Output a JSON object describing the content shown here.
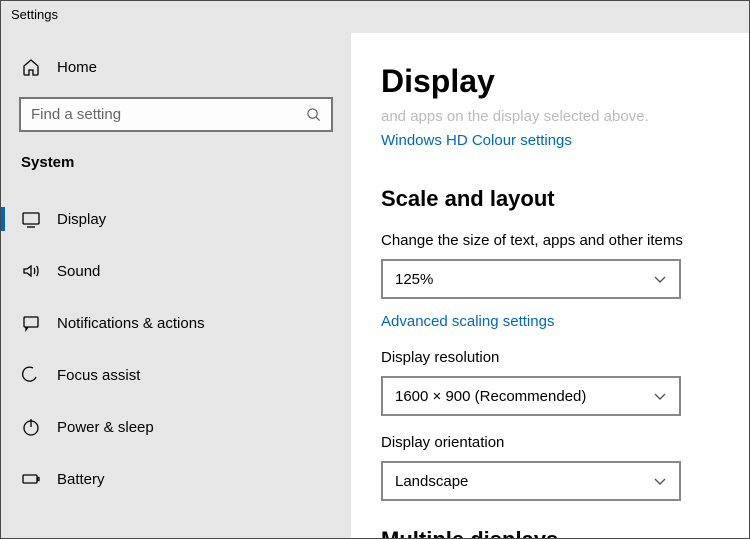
{
  "window": {
    "title": "Settings"
  },
  "sidebar": {
    "home_label": "Home",
    "search_placeholder": "Find a setting",
    "section": "System",
    "items": [
      {
        "label": "Display"
      },
      {
        "label": "Sound"
      },
      {
        "label": "Notifications & actions"
      },
      {
        "label": "Focus assist"
      },
      {
        "label": "Power & sleep"
      },
      {
        "label": "Battery"
      }
    ]
  },
  "content": {
    "title": "Display",
    "ghost_text": "and apps on the display selected above.",
    "hd_link": "Windows HD Colour settings",
    "section_scale": "Scale and layout",
    "label_scale": "Change the size of text, apps and other items",
    "value_scale": "125%",
    "advanced_link": "Advanced scaling settings",
    "label_res": "Display resolution",
    "value_res": "1600 × 900 (Recommended)",
    "label_orient": "Display orientation",
    "value_orient": "Landscape",
    "partial_heading": "Multiple displays"
  }
}
